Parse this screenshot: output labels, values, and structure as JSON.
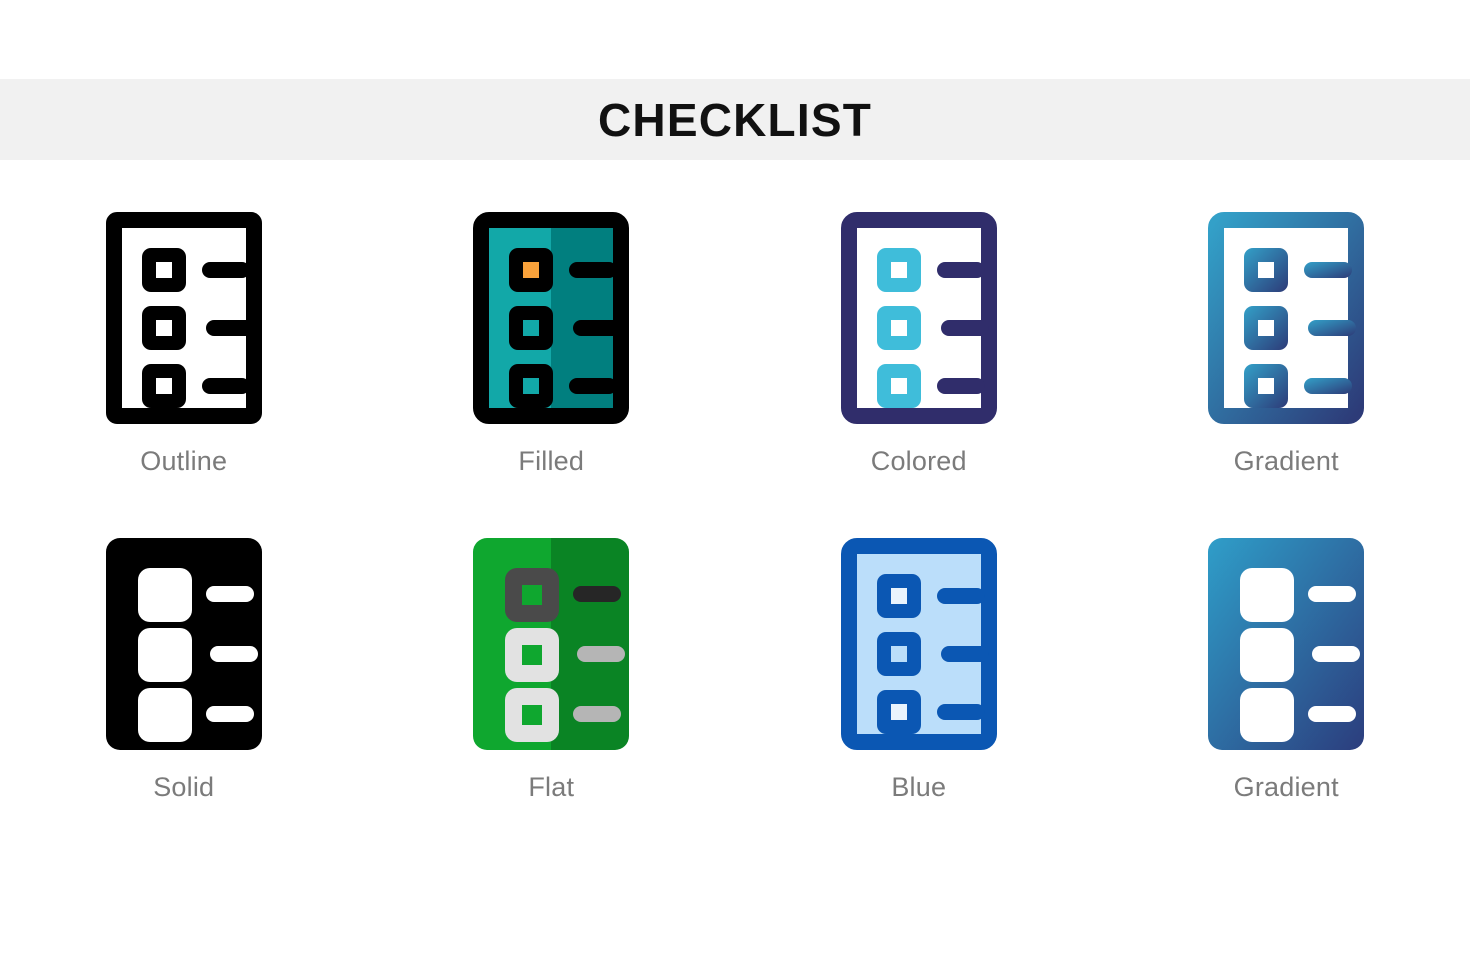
{
  "header": {
    "title": "CHECKLIST",
    "background_color": "#f1f1f1",
    "title_color": "#111111"
  },
  "page": {
    "background_color": "#ffffff",
    "label_color": "#7b7b7b"
  },
  "icon_name": "checklist-icon",
  "grid": {
    "columns": 4,
    "rows": 2
  },
  "variants": [
    {
      "label": "Outline",
      "style": "outline",
      "icon_name": "checklist-icon-outline",
      "colors": {
        "stroke": "#000000",
        "fill": "#ffffff",
        "square": "#000000",
        "square_inner": "#ffffff",
        "bar": "#000000",
        "accent": "#000000"
      }
    },
    {
      "label": "Filled",
      "style": "filled",
      "icon_name": "checklist-icon-filled",
      "colors": {
        "stroke": "#000000",
        "fill_left": "#12a8a8",
        "fill_right": "#017f7f",
        "square": "#000000",
        "square_inner": "#ffffff",
        "bar": "#000000",
        "accent": "#f9a23b"
      }
    },
    {
      "label": "Colored",
      "style": "colored",
      "icon_name": "checklist-icon-colored",
      "colors": {
        "stroke": "#302d6b",
        "fill": "#ffffff",
        "square": "#3fbdda",
        "square_inner": "#ffffff",
        "bar": "#302d6b",
        "accent": "#3fbdda"
      }
    },
    {
      "label": "Gradient",
      "style": "gradient-outline",
      "icon_name": "checklist-icon-gradient-outline",
      "colors": {
        "gradient_start": "#33a0c8",
        "gradient_end": "#2d3b78",
        "fill": "#ffffff",
        "square_inner": "#ffffff"
      }
    },
    {
      "label": "Solid",
      "style": "solid",
      "icon_name": "checklist-icon-solid",
      "colors": {
        "body": "#000000",
        "knockout": "#ffffff"
      }
    },
    {
      "label": "Flat",
      "style": "flat",
      "icon_name": "checklist-icon-flat",
      "colors": {
        "fill_left": "#0fa72f",
        "fill_right": "#0a8424",
        "square_first": "#4a4a4a",
        "square_rest": "#e2e2e2",
        "bar_first": "#262626",
        "bar_rest": "#b5b5b5"
      }
    },
    {
      "label": "Blue",
      "style": "blue",
      "icon_name": "checklist-icon-blue",
      "colors": {
        "stroke": "#0b57b3",
        "fill": "#bbdefa",
        "square": "#0b57b3",
        "square_inner": "#eaf4fd",
        "bar": "#0b57b3"
      }
    },
    {
      "label": "Gradient",
      "style": "gradient-solid",
      "icon_name": "checklist-icon-gradient-solid",
      "colors": {
        "gradient_start": "#2f9ec9",
        "gradient_end": "#2c3d7d",
        "knockout": "#ffffff"
      }
    }
  ]
}
